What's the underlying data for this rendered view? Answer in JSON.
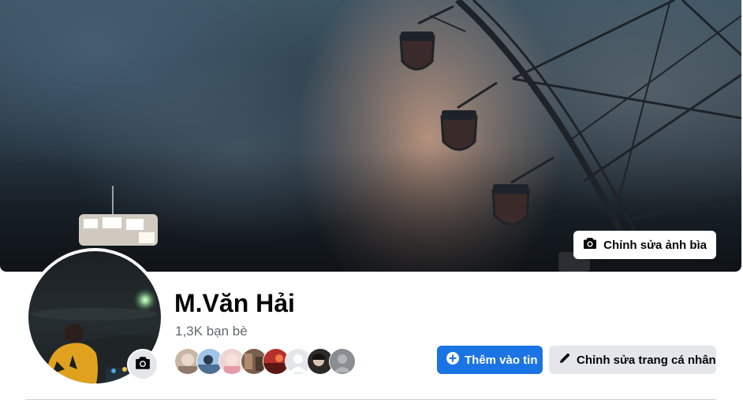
{
  "profile": {
    "name": "M.Văn Hải",
    "friends_count": "1,3K bạn bè"
  },
  "cover": {
    "edit_label": "Chỉnh sửa ảnh bìa"
  },
  "actions": {
    "add_story_label": "Thêm vào tin",
    "edit_profile_label": "Chỉnh sửa trang cá nhân"
  },
  "friend_avatars": [
    {
      "name": "friend-avatar-1",
      "color": "#b9a69a"
    },
    {
      "name": "friend-avatar-2",
      "color": "#8fb3d6"
    },
    {
      "name": "friend-avatar-3",
      "color": "#e9c3c3"
    },
    {
      "name": "friend-avatar-4",
      "color": "#6b5547"
    },
    {
      "name": "friend-avatar-5",
      "color": "#b8302b"
    },
    {
      "name": "friend-avatar-6",
      "color": "#e4e6eb"
    },
    {
      "name": "friend-avatar-7",
      "color": "#2d2926"
    },
    {
      "name": "friend-avatar-8",
      "color": "#8a8d91"
    }
  ],
  "colors": {
    "primary": "#1b74e4",
    "secondary_button": "#e4e6eb",
    "text_primary": "#050505",
    "text_secondary": "#65676b"
  },
  "icons": {
    "cover_camera": "camera-icon",
    "avatar_camera": "camera-icon",
    "add_story": "plus-circle-icon",
    "edit_profile": "pencil-icon"
  }
}
